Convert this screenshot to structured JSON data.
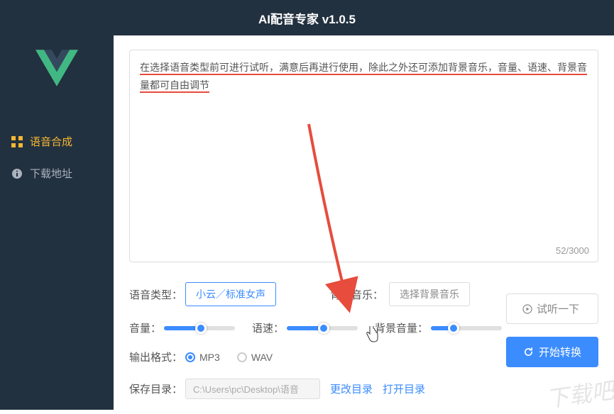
{
  "header": {
    "title": "AI配音专家 v1.0.5"
  },
  "sidebar": {
    "items": [
      {
        "label": "语音合成"
      },
      {
        "label": "下载地址"
      }
    ]
  },
  "textarea": {
    "line1": "在选择语音类型前可进行试听，满意后再进行使用，除此之外还可添加背景音乐，音量、语速、背景音",
    "line2": "量都可自由调节",
    "count": "52/3000"
  },
  "voice": {
    "type_label": "语音类型：",
    "type_value": "小云／标准女声",
    "bg_label": "背景音乐：",
    "bg_value": "选择背景音乐"
  },
  "sliders": {
    "volume_label": "音量：",
    "speed_label": "语速：",
    "bgvol_label": "背景音量："
  },
  "output": {
    "format_label": "输出格式：",
    "opt1": "MP3",
    "opt2": "WAV",
    "dir_label": "保存目录：",
    "dir_value": "C:\\Users\\pc\\Desktop\\语音",
    "change_dir": "更改目录",
    "open_dir": "打开目录"
  },
  "actions": {
    "preview": "试听一下",
    "convert": "开始转换"
  },
  "watermark": "下载吧"
}
